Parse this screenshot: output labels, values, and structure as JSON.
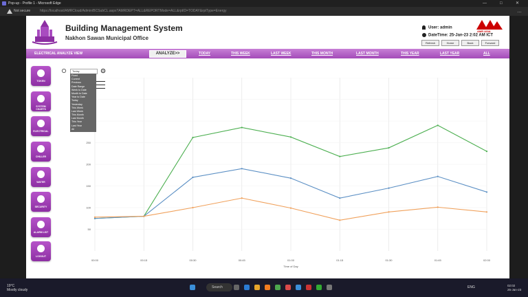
{
  "browser": {
    "title": "Pop-up - Profile 1 - Microsoft Edge",
    "not_secure": "Not secure",
    "url": "https://localhost/AMRCloud/Admin/BCSubCL.aspx?AMRDEPT=ALL&REPORTMode=ALL&rptID=TODAY&rptType=Energy",
    "win_controls": [
      "—",
      "□",
      "✕"
    ],
    "menu_glyph": "…"
  },
  "header": {
    "title": "Building Management System",
    "subtitle": "Nakhon Sawan Municipal Office",
    "brand": "AMR ASIA",
    "user_text": "User: admin",
    "datetime_text": "DateTime: 25-Jan-23 2:02 AM ICT",
    "buttons": [
      "Refresh",
      "Home",
      "Back",
      "Forward"
    ]
  },
  "menubar": {
    "view_label": "ELECTRICAL ANALYZE VIEW",
    "analyze_label": "ANALYZE>>",
    "tabs": [
      "TODAY",
      "THIS WEEK",
      "LAST WEEK",
      "THIS MONTH",
      "LAST MONTH",
      "THIS YEAR",
      "LAST YEAR",
      "ALL"
    ]
  },
  "sidebar": {
    "items": [
      "TOKEN",
      "SYSTEM CHARTS",
      "ELECTRICAL",
      "CHILLER",
      "WATER",
      "SECURITY",
      "ALARM LIST",
      "LOGOUT"
    ]
  },
  "dropdown": {
    "selected": "Today",
    "options": [
      "Fixed",
      "Current",
      "Previous",
      "Date Range",
      "Week to Date",
      "Month to Date",
      "Year to Date",
      "Today",
      "Yesterday",
      "This Week",
      "Last Week",
      "This Month",
      "Last Month",
      "This Year",
      "Last Year",
      "All"
    ]
  },
  "chart_data": {
    "type": "line",
    "xlabel": "Time of Day",
    "categories": [
      "00:00",
      "00:15",
      "00:30",
      "00:45",
      "01:00",
      "01:15",
      "01:30",
      "01:45",
      "02:00"
    ],
    "ylim": [
      0,
      400
    ],
    "yticks": [
      50,
      100,
      150,
      200,
      250,
      300,
      350,
      400
    ],
    "grid": true,
    "series": [
      {
        "color": "#4caf50",
        "values": [
          75,
          80,
          262,
          285,
          263,
          218,
          238,
          290,
          230
        ]
      },
      {
        "color": "#5b8fc4",
        "values": [
          75,
          80,
          170,
          190,
          168,
          122,
          145,
          172,
          136
        ]
      },
      {
        "color": "#f0a05a",
        "values": [
          78,
          80,
          100,
          122,
          99,
          71,
          90,
          101,
          90
        ]
      }
    ]
  },
  "taskbar": {
    "weather_temp": "19°C",
    "weather_desc": "Mostly cloudy",
    "search": "Search",
    "lang": "ENG",
    "time": "02:02",
    "date": "25-Jan-23"
  }
}
